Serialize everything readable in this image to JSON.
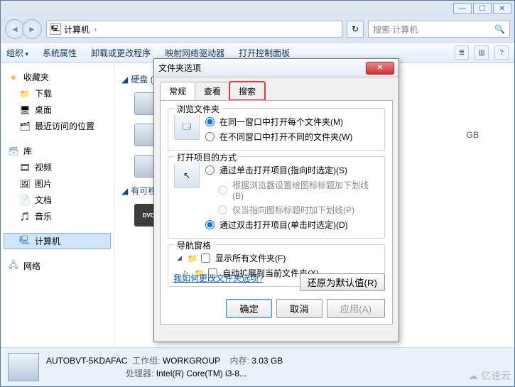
{
  "titlebar": {
    "min": "—",
    "max": "☐",
    "close": "✕"
  },
  "address": {
    "location": "计算机",
    "sep": "›"
  },
  "search": {
    "placeholder": "搜索 计算机"
  },
  "toolbar": {
    "organize": "组织",
    "sysprops": "系统属性",
    "uninstall": "卸载或更改程序",
    "mapdrive": "映射网络驱动器",
    "ctrlpanel": "打开控制面板"
  },
  "sidebar": {
    "favorites": "收藏夹",
    "downloads": "下载",
    "desktop": "桌面",
    "recent": "最近访问的位置",
    "libraries": "库",
    "videos": "视频",
    "pictures": "图片",
    "documents": "文档",
    "music": "音乐",
    "computer": "计算机",
    "network": "网络"
  },
  "main": {
    "hdd_section": "硬盘 (",
    "removable_section": "有可移"
  },
  "rightinfo": {
    "gb": "GB"
  },
  "status": {
    "name": "AUTOBVT-5KDAFAC",
    "workgroup_label": "工作组:",
    "workgroup": "WORKGROUP",
    "mem_label": "内存:",
    "mem": "3.03 GB",
    "cpu_label": "处理器:",
    "cpu": "Intel(R) Core(TM) i3-8..."
  },
  "dialog": {
    "title": "文件夹选项",
    "tabs": {
      "general": "常规",
      "view": "查看",
      "search": "搜索"
    },
    "browse": {
      "legend": "浏览文件夹",
      "same": "在同一窗口中打开每个文件夹(M)",
      "own": "在不同窗口中打开不同的文件夹(W)"
    },
    "click": {
      "legend": "打开项目的方式",
      "single": "通过单击打开项目(指向时选定)(S)",
      "und_browser": "根据浏览器设置给图标标题加下划线(B)",
      "und_hover": "仅当指向图标标题时加下划线(P)",
      "double": "通过双击打开项目(单击时选定)(D)"
    },
    "navpane": {
      "legend": "导航窗格",
      "showall": "显示所有文件夹(F)",
      "autoexpand": "自动扩展到当前文件夹(X)"
    },
    "restore": "还原为默认值(R)",
    "help": "我如何更改文件夹选项?",
    "ok": "确定",
    "cancel": "取消",
    "apply": "应用(A)"
  },
  "watermark": "亿速云"
}
